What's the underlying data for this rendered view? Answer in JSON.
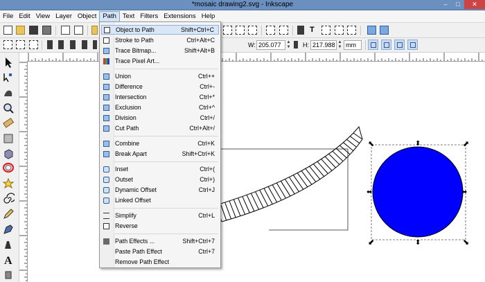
{
  "window": {
    "title": "*mosaic drawing2.svg - Inkscape",
    "controls": [
      "–",
      "□",
      "✕"
    ]
  },
  "menubar": {
    "items": [
      {
        "id": "file",
        "label": "File"
      },
      {
        "id": "edit",
        "label": "Edit"
      },
      {
        "id": "view",
        "label": "View"
      },
      {
        "id": "layer",
        "label": "Layer"
      },
      {
        "id": "object",
        "label": "Object"
      },
      {
        "id": "path",
        "label": "Path",
        "active": true
      },
      {
        "id": "text",
        "label": "Text"
      },
      {
        "id": "filters",
        "label": "Filters"
      },
      {
        "id": "extensions",
        "label": "Extensions"
      },
      {
        "id": "help",
        "label": "Help"
      }
    ]
  },
  "controls_bar": {
    "w_label": "W:",
    "w_value": "205.077",
    "h_label": "H:",
    "h_value": "217.988",
    "unit": "mm"
  },
  "path_menu": {
    "items": [
      {
        "label": "Object to Path",
        "accel": "Shift+Ctrl+C",
        "icon": "object-to-path-icon",
        "highlighted": true
      },
      {
        "label": "Stroke to Path",
        "accel": "Ctrl+Alt+C",
        "icon": "stroke-to-path-icon"
      },
      {
        "label": "Trace Bitmap...",
        "accel": "Shift+Alt+B",
        "icon": "trace-bitmap-icon"
      },
      {
        "label": "Trace Pixel Art...",
        "accel": "",
        "icon": "trace-pixel-art-icon"
      },
      {
        "label": "Union",
        "accel": "Ctrl++",
        "icon": "union-icon"
      },
      {
        "label": "Difference",
        "accel": "Ctrl+-",
        "icon": "difference-icon"
      },
      {
        "label": "Intersection",
        "accel": "Ctrl+*",
        "icon": "intersection-icon"
      },
      {
        "label": "Exclusion",
        "accel": "Ctrl+^",
        "icon": "exclusion-icon"
      },
      {
        "label": "Division",
        "accel": "Ctrl+/",
        "icon": "division-icon"
      },
      {
        "label": "Cut Path",
        "accel": "Ctrl+Alt+/",
        "icon": "cut-path-icon"
      },
      {
        "label": "Combine",
        "accel": "Ctrl+K",
        "icon": "combine-icon"
      },
      {
        "label": "Break Apart",
        "accel": "Shift+Ctrl+K",
        "icon": "break-apart-icon"
      },
      {
        "label": "Inset",
        "accel": "Ctrl+(",
        "icon": "inset-icon"
      },
      {
        "label": "Outset",
        "accel": "Ctrl+)",
        "icon": "outset-icon"
      },
      {
        "label": "Dynamic Offset",
        "accel": "Ctrl+J",
        "icon": "dynamic-offset-icon"
      },
      {
        "label": "Linked Offset",
        "accel": "",
        "icon": "linked-offset-icon"
      },
      {
        "label": "Simplify",
        "accel": "Ctrl+L",
        "icon": "simplify-icon"
      },
      {
        "label": "Reverse",
        "accel": "",
        "icon": "reverse-icon"
      },
      {
        "label": "Path Effects ...",
        "accel": "Shift+Ctrl+7",
        "icon": "path-effects-icon"
      },
      {
        "label": "Paste Path Effect",
        "accel": "Ctrl+7",
        "icon": ""
      },
      {
        "label": "Remove Path Effect",
        "accel": "",
        "icon": ""
      }
    ]
  },
  "colors": {
    "circle_fill": "#0000ff",
    "selection_accent": "#2e5e9e"
  }
}
